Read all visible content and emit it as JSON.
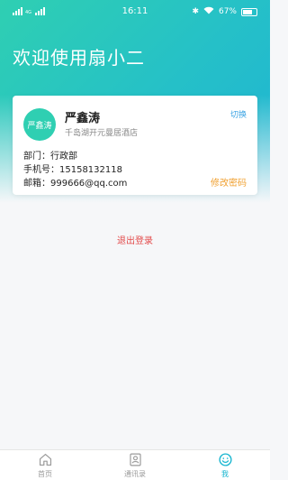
{
  "status_bar": {
    "signal_tag": "4G",
    "time": "16:11",
    "battery_percent": "67%"
  },
  "header": {
    "welcome": "欢迎使用扇小二"
  },
  "profile": {
    "avatar_text": "严鑫涛",
    "name": "严鑫涛",
    "company": "千岛湖开元曼居酒店",
    "switch_label": "切换",
    "department": "部门：行政部",
    "phone": "手机号：15158132118",
    "email": "邮箱：999666@qq.com",
    "change_password": "修改密码"
  },
  "logout_label": "退出登录",
  "tabbar": {
    "items": [
      {
        "label": "首页",
        "icon": "home-icon"
      },
      {
        "label": "通讯录",
        "icon": "contacts-icon"
      },
      {
        "label": "我",
        "icon": "smile-icon"
      }
    ]
  },
  "colors": {
    "accent": "#2fcfb2",
    "tab_active": "#18b6d0",
    "logout": "#e34b4b",
    "link": "#3aa3e3",
    "change_password": "#f0a030"
  }
}
